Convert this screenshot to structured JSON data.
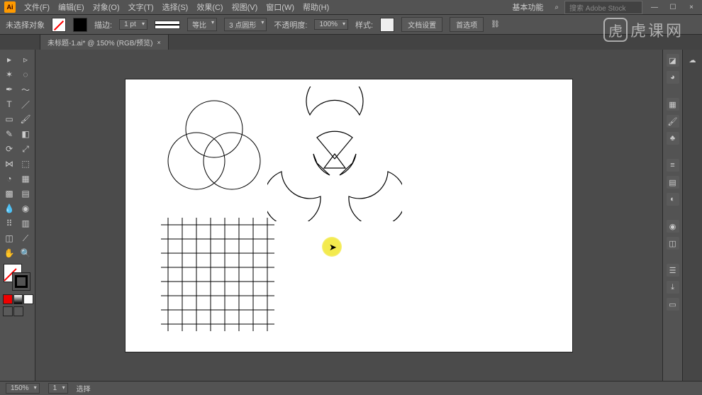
{
  "app": {
    "logo": "Ai"
  },
  "menu": {
    "file": "文件(F)",
    "edit": "编辑(E)",
    "object": "对象(O)",
    "type": "文字(T)",
    "select": "选择(S)",
    "effect": "效果(C)",
    "view": "视图(V)",
    "window": "窗口(W)",
    "help": "帮助(H)"
  },
  "title_right": {
    "workspace": "基本功能",
    "search_placeholder": "搜索 Adobe Stock"
  },
  "control": {
    "no_selection": "未选择对象",
    "stroke_label": "描边:",
    "stroke_weight": "1 pt",
    "stroke_align": "等比",
    "stroke_profile": "3 点圆形",
    "opacity_label": "不透明度:",
    "opacity": "100%",
    "style_label": "样式:",
    "doc_setup": "文档设置",
    "preferences": "首选项"
  },
  "tab": {
    "name": "未标题-1.ai* @ 150% (RGB/预览)",
    "close": "×"
  },
  "statusbar": {
    "zoom": "150%",
    "artboard_nav": "1",
    "tool_label": "选择"
  },
  "watermark": {
    "icon": "虎",
    "text": "虎课网"
  },
  "icons": {
    "min": "—",
    "max": "☐",
    "close": "×",
    "search": "⌕",
    "dropdown": "▾",
    "chain": "⛓"
  }
}
